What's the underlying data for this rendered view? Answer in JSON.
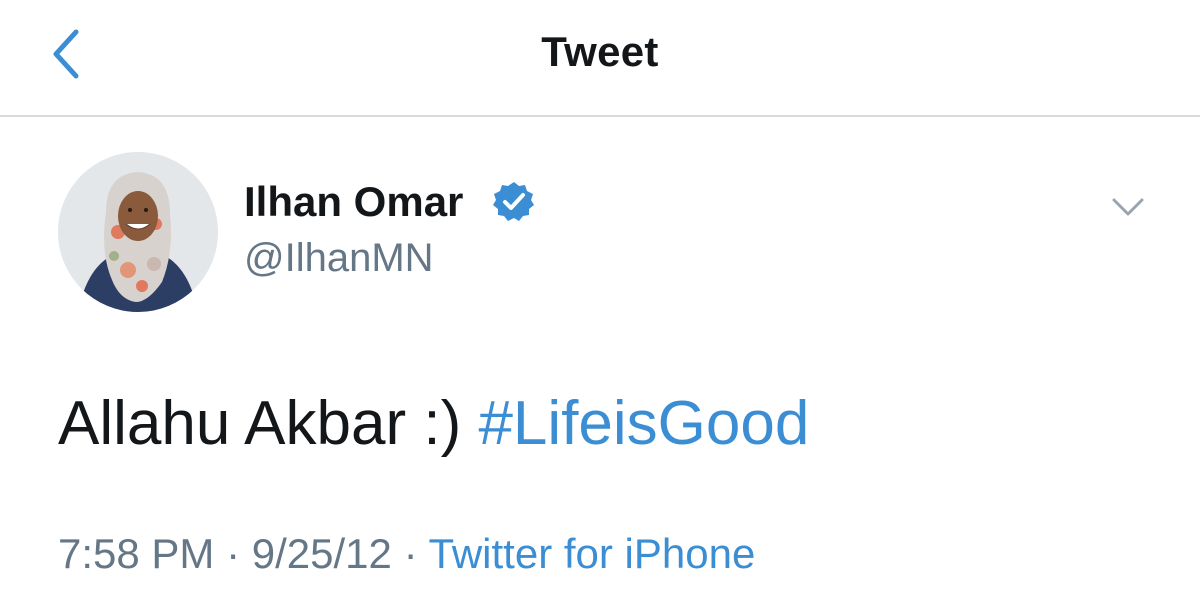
{
  "header": {
    "title": "Tweet"
  },
  "tweet": {
    "author_name": "Ilhan Omar",
    "author_handle": "@IlhanMN",
    "verified": true,
    "text": "Allahu Akbar :)",
    "hashtag": "#LifeisGood",
    "time": "7:58 PM",
    "separator": "·",
    "date": "9/25/12",
    "source": "Twitter for iPhone"
  },
  "colors": {
    "accent": "#3b8ed3",
    "text": "#14171a",
    "secondary": "#657786",
    "divider": "#d8dadd"
  },
  "icons": {
    "back": "chevron-left-icon",
    "verified": "verified-badge-icon",
    "more": "chevron-down-icon"
  }
}
